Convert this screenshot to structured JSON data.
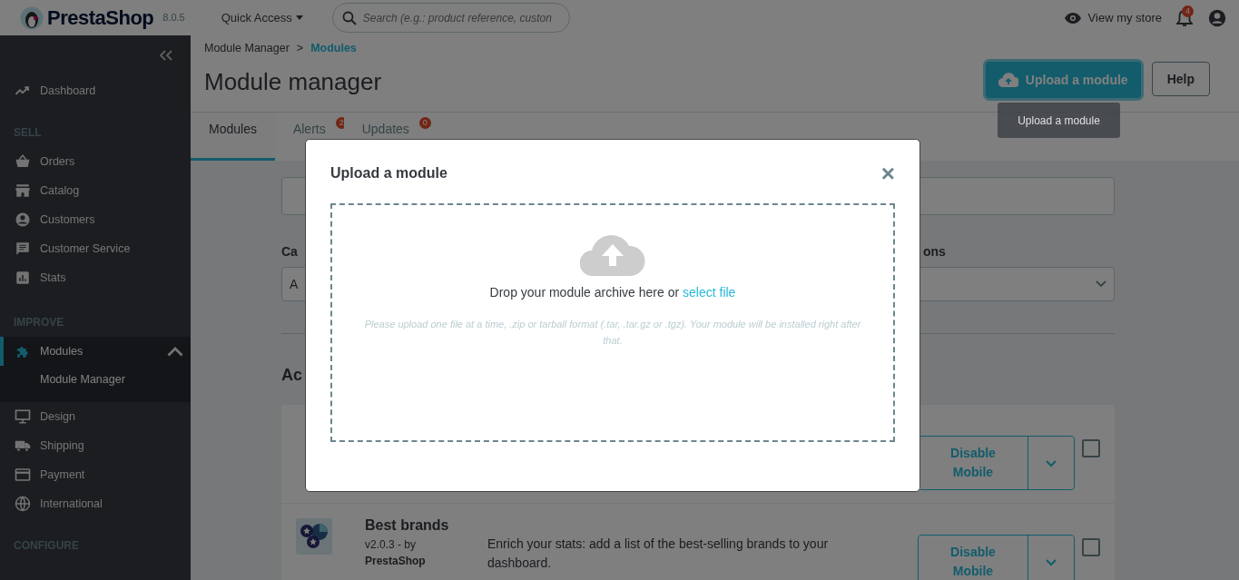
{
  "header": {
    "logo_text": "PrestaShop",
    "version": "8.0.5",
    "quick_access": "Quick Access",
    "search": {
      "placeholder": "Search (e.g.: product reference, custon"
    },
    "view_store": "View my store",
    "notifications_count": "4"
  },
  "sidebar": {
    "sections": [
      {
        "items": [
          {
            "label": "Dashboard",
            "selected": false,
            "expanded": false
          }
        ]
      },
      {
        "title": "SELL",
        "items": [
          {
            "label": "Orders",
            "selected": false,
            "expanded": false
          },
          {
            "label": "Catalog",
            "selected": false,
            "expanded": false
          },
          {
            "label": "Customers",
            "selected": false,
            "expanded": false
          },
          {
            "label": "Customer Service",
            "selected": false,
            "expanded": false
          },
          {
            "label": "Stats",
            "selected": false,
            "expanded": false
          }
        ]
      },
      {
        "title": "IMPROVE",
        "items": [
          {
            "label": "Modules",
            "selected": true,
            "expanded": true,
            "children": [
              {
                "label": "Module Manager",
                "selected": true
              }
            ]
          },
          {
            "label": "Design",
            "selected": false,
            "expanded": false
          },
          {
            "label": "Shipping",
            "selected": false,
            "expanded": false
          },
          {
            "label": "Payment",
            "selected": false,
            "expanded": false
          },
          {
            "label": "International",
            "selected": false,
            "expanded": false
          }
        ]
      },
      {
        "title": "CONFIGURE"
      }
    ]
  },
  "breadcrumb": [
    {
      "label": "Module Manager",
      "selected": false
    },
    {
      "label": "Modules",
      "selected": true
    }
  ],
  "breadcrumb_separator": ">",
  "page_title": "Module manager",
  "toolbar": {
    "upload_button": {
      "label": "Upload a module",
      "focused": true
    },
    "help_button": "Help",
    "tooltip": "Upload a module"
  },
  "tabs": [
    {
      "label": "Modules",
      "selected": true
    },
    {
      "label": "Alerts",
      "selected": false,
      "badge": "2"
    },
    {
      "label": "Updates",
      "selected": false,
      "badge": "0"
    }
  ],
  "filters": {
    "category_label": "Ca",
    "category_value": "A",
    "column_2_label": "ons"
  },
  "section_heading": "Ac",
  "modules": [
    {
      "action": "Disable Mobile",
      "checked": false
    },
    {
      "name": "Best brands",
      "version": "v2.0.3 - by",
      "author": "PrestaShop",
      "description": "Enrich your stats: add a list of the best-selling brands to your dashboard.",
      "action": "Disable Mobile",
      "checked": false
    }
  ],
  "modal": {
    "title": "Upload a module",
    "close": "×",
    "drop_text": "Drop your module archive here or ",
    "drop_link": "select file",
    "hint": "Please upload one file at a time, .zip or tarball format (.tar, .tar.gz or .tgz). Your module will be installed right after that."
  }
}
